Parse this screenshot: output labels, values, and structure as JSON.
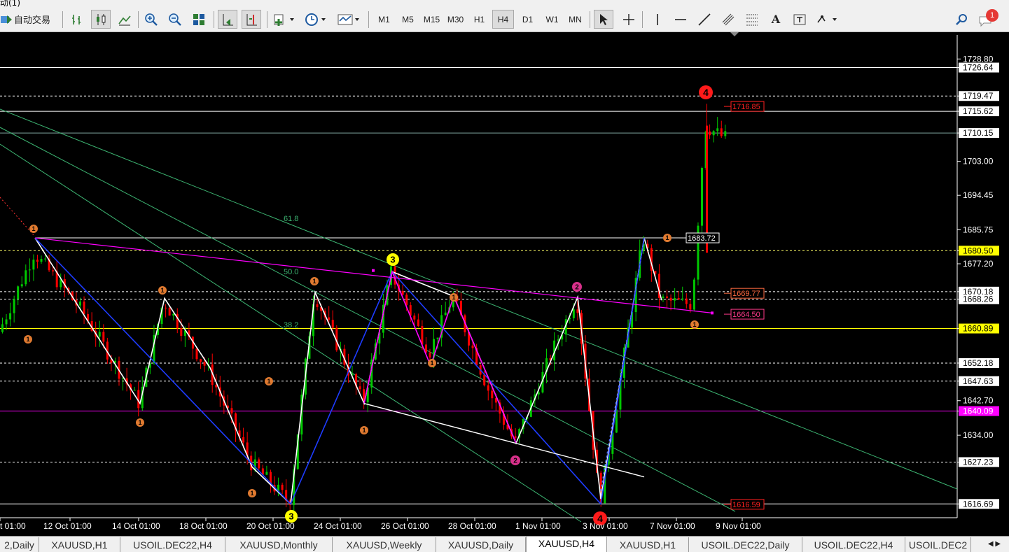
{
  "window": {
    "title_fragment": "动(1)"
  },
  "toolbar": {
    "autotrade_label": "自动交易",
    "timeframes": [
      "M1",
      "M5",
      "M15",
      "M30",
      "H1",
      "H4",
      "D1",
      "W1",
      "MN"
    ],
    "active_timeframe": "H4",
    "notification_count": "1",
    "text_tool_label": "A"
  },
  "chart": {
    "symbol": "XAUUSD,H4",
    "price_labels": [
      {
        "price": "1728.80",
        "kind": "axis"
      },
      {
        "price": "1726.64",
        "kind": "hline-white"
      },
      {
        "price": "1719.47",
        "kind": "dashed-white"
      },
      {
        "price": "1715.62",
        "kind": "hline-white"
      },
      {
        "price": "1710.15",
        "kind": "current-bid"
      },
      {
        "price": "1703.00",
        "kind": "axis"
      },
      {
        "price": "1694.45",
        "kind": "axis"
      },
      {
        "price": "1685.75",
        "kind": "axis"
      },
      {
        "price": "1680.50",
        "kind": "yellow-dashed"
      },
      {
        "price": "1677.20",
        "kind": "axis"
      },
      {
        "price": "1670.18",
        "kind": "dashed-white"
      },
      {
        "price": "1668.26",
        "kind": "dashed-white"
      },
      {
        "price": "1660.89",
        "kind": "yellow-line"
      },
      {
        "price": "1652.18",
        "kind": "dashed-white"
      },
      {
        "price": "1647.63",
        "kind": "dashed-white"
      },
      {
        "price": "1642.70",
        "kind": "axis"
      },
      {
        "price": "1640.09",
        "kind": "magenta-line"
      },
      {
        "price": "1634.00",
        "kind": "axis"
      },
      {
        "price": "1627.23",
        "kind": "dashed-white"
      },
      {
        "price": "1616.69",
        "kind": "hline-white"
      }
    ],
    "date_labels": [
      "t 01:00",
      "12 Oct 01:00",
      "14 Oct 01:00",
      "18 Oct 01:00",
      "20 Oct 01:00",
      "24 Oct 01:00",
      "26 Oct 01:00",
      "28 Oct 01:00",
      "1 Nov 01:00",
      "3 Nov 01:00",
      "7 Nov 01:00",
      "9 Nov 01:00"
    ],
    "fib_levels": [
      "61.8",
      "50.0",
      "38.2"
    ],
    "boxed_labels": [
      "1716.85",
      "1683.72",
      "1669.77",
      "1664.50",
      "1616.59"
    ],
    "wave_markers": [
      "1",
      "1",
      "1",
      "1",
      "1",
      "1",
      "1",
      "1",
      "1",
      "1",
      "1",
      "1",
      "2",
      "2",
      "2",
      "3",
      "3",
      "4",
      "4"
    ],
    "colors": {
      "bull": "#00c800",
      "bear": "#ff0000",
      "magenta": "#ff00ff",
      "zigzag_blue": "#1e3cff",
      "fib": "#3cb371",
      "yellow": "#ffff00"
    }
  },
  "tabs": [
    "2,Daily",
    "XAUUSD,H1",
    "USOIL.DEC22,H4",
    "XAUUSD,Monthly",
    "XAUUSD,Weekly",
    "XAUUSD,Daily",
    "XAUUSD,H4",
    "XAUUSD,H1",
    "USOIL.DEC22,Daily",
    "USOIL.DEC22,H4",
    "USOIL.DEC2"
  ],
  "active_tab": "XAUUSD,H4"
}
